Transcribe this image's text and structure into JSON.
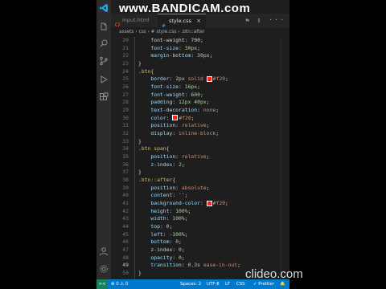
{
  "watermarks": {
    "bandicam": "www.BANDICAM.com",
    "clideo": "clideo.com"
  },
  "activity_bar": {
    "icons": [
      "explorer-icon",
      "search-icon",
      "source-control-icon",
      "run-debug-icon",
      "extensions-icon",
      "account-icon",
      "settings-gear-icon"
    ]
  },
  "tabs": [
    {
      "label": "input.html",
      "active": false
    },
    {
      "label": "style.css",
      "active": true
    }
  ],
  "tab_close": "×",
  "tabbar_icons": "⇆ ▯ ···",
  "breadcrumb": "assets › css › # style.css › .btn::after",
  "editor": {
    "lines": [
      {
        "n": "20",
        "tokens": [
          [
            "pun",
            "    font-weight: 700;"
          ]
        ]
      },
      {
        "n": "21",
        "tokens": [
          [
            "prop",
            "    font-size"
          ],
          [
            "pun",
            ": "
          ],
          [
            "num",
            "30px"
          ],
          [
            "pun",
            ";"
          ]
        ]
      },
      {
        "n": "22",
        "tokens": [
          [
            "prop",
            "    margin-bottom"
          ],
          [
            "pun",
            ": "
          ],
          [
            "num",
            "30px"
          ],
          [
            "pun",
            ";"
          ]
        ]
      },
      {
        "n": "23",
        "tokens": [
          [
            "pun",
            "}"
          ]
        ]
      },
      {
        "n": "24",
        "tokens": [
          [
            "sel",
            ".btn"
          ],
          [
            "pun",
            "{"
          ]
        ]
      },
      {
        "n": "25",
        "tokens": [
          [
            "prop",
            "    border"
          ],
          [
            "pun",
            ": "
          ],
          [
            "num",
            "2px"
          ],
          [
            "str",
            " solid "
          ],
          [
            "swatch",
            ""
          ],
          [
            "str",
            "#f20"
          ],
          [
            "pun",
            ";"
          ]
        ]
      },
      {
        "n": "26",
        "tokens": [
          [
            "prop",
            "    font-size"
          ],
          [
            "pun",
            ": "
          ],
          [
            "num",
            "16px"
          ],
          [
            "pun",
            ";"
          ]
        ]
      },
      {
        "n": "27",
        "tokens": [
          [
            "prop",
            "    font-weight"
          ],
          [
            "pun",
            ": "
          ],
          [
            "num",
            "600"
          ],
          [
            "pun",
            ";"
          ]
        ]
      },
      {
        "n": "28",
        "tokens": [
          [
            "prop",
            "    padding"
          ],
          [
            "pun",
            ": "
          ],
          [
            "num",
            "12px 40px"
          ],
          [
            "pun",
            ";"
          ]
        ]
      },
      {
        "n": "29",
        "tokens": [
          [
            "prop",
            "    text-decoration"
          ],
          [
            "pun",
            ": "
          ],
          [
            "str",
            "none"
          ],
          [
            "pun",
            ";"
          ]
        ]
      },
      {
        "n": "30",
        "tokens": [
          [
            "prop",
            "    color"
          ],
          [
            "pun",
            ": "
          ],
          [
            "swatch",
            ""
          ],
          [
            "str",
            "#f20"
          ],
          [
            "pun",
            ";"
          ]
        ]
      },
      {
        "n": "31",
        "tokens": [
          [
            "prop",
            "    position"
          ],
          [
            "pun",
            ": "
          ],
          [
            "str",
            "relative"
          ],
          [
            "pun",
            ";"
          ]
        ]
      },
      {
        "n": "32",
        "tokens": [
          [
            "prop",
            "    display"
          ],
          [
            "pun",
            ": "
          ],
          [
            "str",
            "inline-block"
          ],
          [
            "pun",
            ";"
          ]
        ]
      },
      {
        "n": "33",
        "tokens": [
          [
            "pun",
            "}"
          ]
        ]
      },
      {
        "n": "34",
        "tokens": [
          [
            "sel",
            ".btn span"
          ],
          [
            "pun",
            "{"
          ]
        ]
      },
      {
        "n": "35",
        "tokens": [
          [
            "prop",
            "    position"
          ],
          [
            "pun",
            ": "
          ],
          [
            "str",
            "relative"
          ],
          [
            "pun",
            ";"
          ]
        ]
      },
      {
        "n": "36",
        "tokens": [
          [
            "prop",
            "    z-index"
          ],
          [
            "pun",
            ": "
          ],
          [
            "num",
            "2"
          ],
          [
            "pun",
            ";"
          ]
        ]
      },
      {
        "n": "37",
        "tokens": [
          [
            "pun",
            "}"
          ]
        ]
      },
      {
        "n": "38",
        "tokens": [
          [
            "sel",
            ".btn::after"
          ],
          [
            "pun",
            "{"
          ]
        ]
      },
      {
        "n": "39",
        "tokens": [
          [
            "prop",
            "    position"
          ],
          [
            "pun",
            ": "
          ],
          [
            "str",
            "absolute"
          ],
          [
            "pun",
            ";"
          ]
        ]
      },
      {
        "n": "40",
        "tokens": [
          [
            "prop",
            "    content"
          ],
          [
            "pun",
            ": "
          ],
          [
            "str",
            "''"
          ],
          [
            "pun",
            ";"
          ]
        ]
      },
      {
        "n": "41",
        "tokens": [
          [
            "prop",
            "    background-color"
          ],
          [
            "pun",
            ": "
          ],
          [
            "swatch",
            ""
          ],
          [
            "str",
            "#f20"
          ],
          [
            "pun",
            ";"
          ]
        ]
      },
      {
        "n": "42",
        "tokens": [
          [
            "prop",
            "    height"
          ],
          [
            "pun",
            ": "
          ],
          [
            "num",
            "100%"
          ],
          [
            "pun",
            ";"
          ]
        ]
      },
      {
        "n": "43",
        "tokens": [
          [
            "prop",
            "    width"
          ],
          [
            "pun",
            ": "
          ],
          [
            "num",
            "100%"
          ],
          [
            "pun",
            ";"
          ]
        ]
      },
      {
        "n": "44",
        "tokens": [
          [
            "prop",
            "    top"
          ],
          [
            "pun",
            ": "
          ],
          [
            "num",
            "0"
          ],
          [
            "pun",
            ";"
          ]
        ]
      },
      {
        "n": "45",
        "tokens": [
          [
            "prop",
            "    left"
          ],
          [
            "pun",
            ": "
          ],
          [
            "num",
            "-100%"
          ],
          [
            "pun",
            ";"
          ]
        ]
      },
      {
        "n": "46",
        "tokens": [
          [
            "prop",
            "    bottom"
          ],
          [
            "pun",
            ": "
          ],
          [
            "num",
            "0"
          ],
          [
            "pun",
            ";"
          ]
        ]
      },
      {
        "n": "47",
        "tokens": [
          [
            "prop",
            "    z-index"
          ],
          [
            "pun",
            ": "
          ],
          [
            "num",
            "0"
          ],
          [
            "pun",
            ";"
          ]
        ]
      },
      {
        "n": "48",
        "tokens": [
          [
            "prop",
            "    opacity"
          ],
          [
            "pun",
            ": "
          ],
          [
            "num",
            "0"
          ],
          [
            "pun",
            ";"
          ]
        ]
      },
      {
        "n": "49",
        "active": true,
        "tokens": [
          [
            "prop",
            "    transition"
          ],
          [
            "pun",
            ": "
          ],
          [
            "num",
            "0.3s"
          ],
          [
            "str",
            " ease-in-out"
          ],
          [
            "pun",
            ";"
          ]
        ]
      },
      {
        "n": "50",
        "tokens": [
          [
            "pun",
            "}"
          ]
        ]
      }
    ]
  },
  "statusbar": {
    "remote": "><",
    "problems": "⊗ 0 ⚠ 0",
    "spaces": "Spaces: 2",
    "encoding": "UTF-8",
    "eol": "LF",
    "language": "CSS",
    "formatter": "✓ Prettier",
    "bell": "🔔"
  },
  "colors": {
    "accent": "#007acc",
    "swatch": "#ff2020",
    "background": "#1e1e1e"
  }
}
